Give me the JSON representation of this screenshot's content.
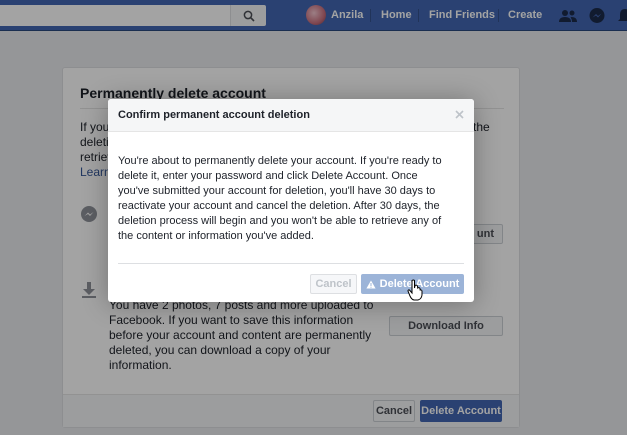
{
  "topbar": {
    "search_icon": "search-icon",
    "user_name": "Anzila",
    "nav": [
      "Home",
      "Find Friends",
      "Create"
    ],
    "icons": [
      "friends-icon",
      "messenger-icon",
      "notifications-icon"
    ]
  },
  "card": {
    "title": "Permanently delete account",
    "intro_fragments": [
      "If you",
      "deleti",
      "retriev"
    ],
    "intro_link": "Learn",
    "side_fragment": "the",
    "row1_icon": "messenger-icon",
    "row1_button_fragment": "unt",
    "row2_icon": "download-icon",
    "row2_lines": [
      "You have 2 photos, 7 posts and more uploaded to",
      "Facebook. If you want to save this information",
      "before your account and content are permanently",
      "deleted, you can download a copy of your",
      "information."
    ],
    "download_button": "Download Info",
    "footer_cancel": "Cancel",
    "footer_delete": "Delete Account"
  },
  "modal": {
    "title": "Confirm permanent account deletion",
    "close_icon": "close-icon",
    "body_lines": [
      "You're about to permanently delete your account. If you're ready to",
      "delete it, enter your password and click Delete Account. Once",
      "you've submitted your account for deletion, you'll have 30 days to",
      "reactivate your account and cancel the deletion. After 30 days, the",
      "deletion process will begin and you won't be able to retrieve any of",
      "the content or information you've added."
    ],
    "cancel_label": "Cancel",
    "delete_label": "Delete Account",
    "warning_icon": "warning-icon"
  },
  "cursor_icon": "hand-pointer-icon"
}
